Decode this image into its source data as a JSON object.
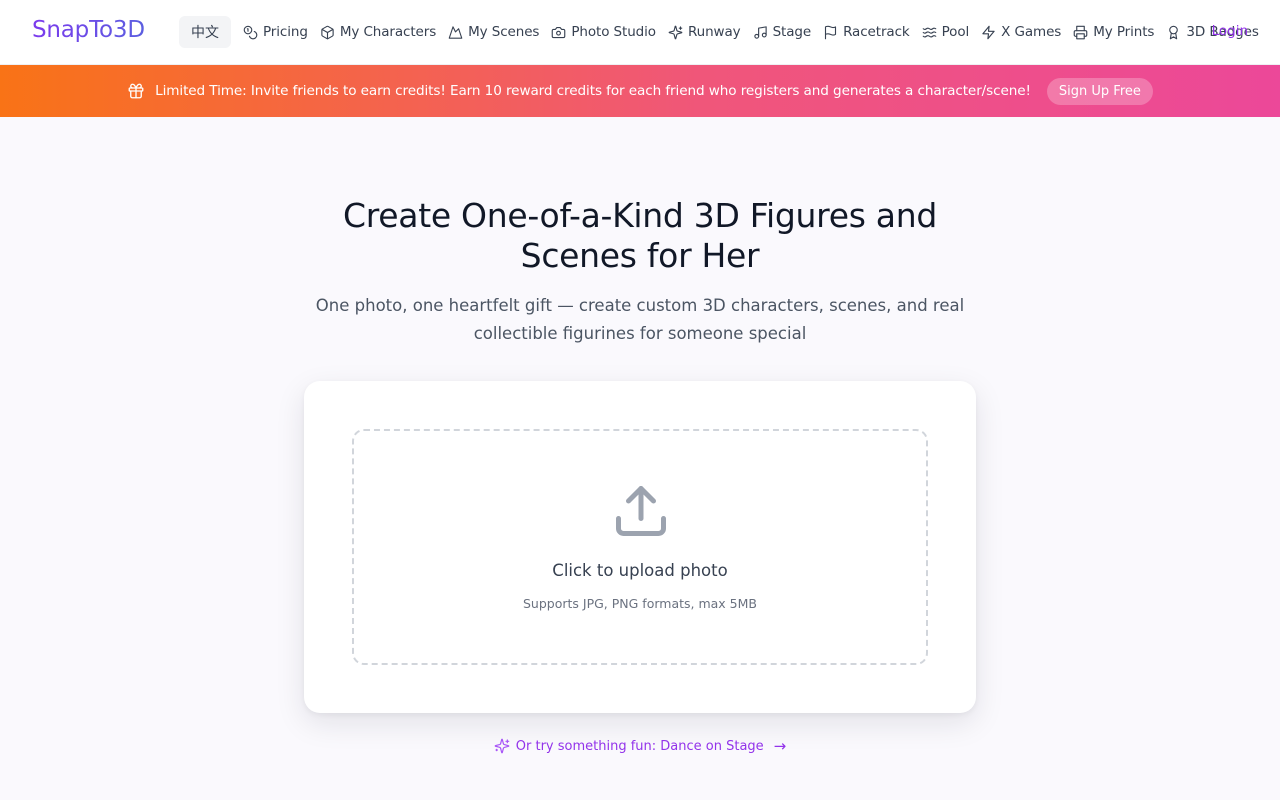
{
  "header": {
    "logo": "SnapTo3D",
    "language_button": "中文",
    "nav": [
      {
        "label": "Pricing",
        "icon": "coins-icon"
      },
      {
        "label": "My Characters",
        "icon": "cube-icon"
      },
      {
        "label": "My Scenes",
        "icon": "mountain-icon"
      },
      {
        "label": "Photo Studio",
        "icon": "camera-icon"
      },
      {
        "label": "Runway",
        "icon": "sparkles-icon"
      },
      {
        "label": "Stage",
        "icon": "music-note-icon"
      },
      {
        "label": "Racetrack",
        "icon": "flag-icon"
      },
      {
        "label": "Pool",
        "icon": "waves-icon"
      },
      {
        "label": "X Games",
        "icon": "lightning-icon"
      },
      {
        "label": "My Prints",
        "icon": "printer-icon"
      },
      {
        "label": "3D Badges",
        "icon": "award-icon"
      }
    ],
    "login": "Login"
  },
  "banner": {
    "icon": "gift-icon",
    "text": "Limited Time: Invite friends to earn credits! Earn 10 reward credits for each friend who registers and generates a character/scene!",
    "button": "Sign Up Free"
  },
  "hero": {
    "title": "Create One-of-a-Kind 3D Figures and Scenes for Her",
    "subtitle": "One photo, one heartfelt gift — create custom 3D characters, scenes, and real collectible figurines for someone special"
  },
  "upload": {
    "icon": "upload-icon",
    "title": "Click to upload photo",
    "hint": "Supports JPG, PNG formats, max 5MB"
  },
  "fun_link": {
    "icon": "sparkles-icon",
    "text": "Or try something fun: Dance on Stage",
    "arrow": "→"
  },
  "colors": {
    "accent": "#9333ea",
    "logo_gradient_start": "#7c3aed",
    "logo_gradient_end": "#5b5fe0",
    "banner_gradient_start": "#f97316",
    "banner_gradient_end": "#ec4899"
  }
}
